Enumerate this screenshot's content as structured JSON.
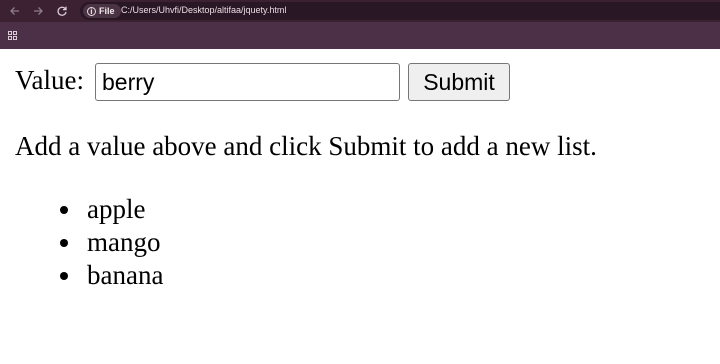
{
  "browser": {
    "site_chip_label": "File",
    "url": "C:/Users/Uhvfi/Desktop/altifaa/jquety.html",
    "icons": [
      "back-arrow-icon",
      "forward-arrow-icon",
      "reload-icon",
      "info-icon",
      "apps-grid-icon"
    ]
  },
  "form": {
    "label": "Value:",
    "input_value": "berry",
    "submit_label": "Submit"
  },
  "instructions": "Add a value above and click Submit to add a new list.",
  "list": {
    "items": [
      "apple",
      "mango",
      "banana"
    ]
  }
}
